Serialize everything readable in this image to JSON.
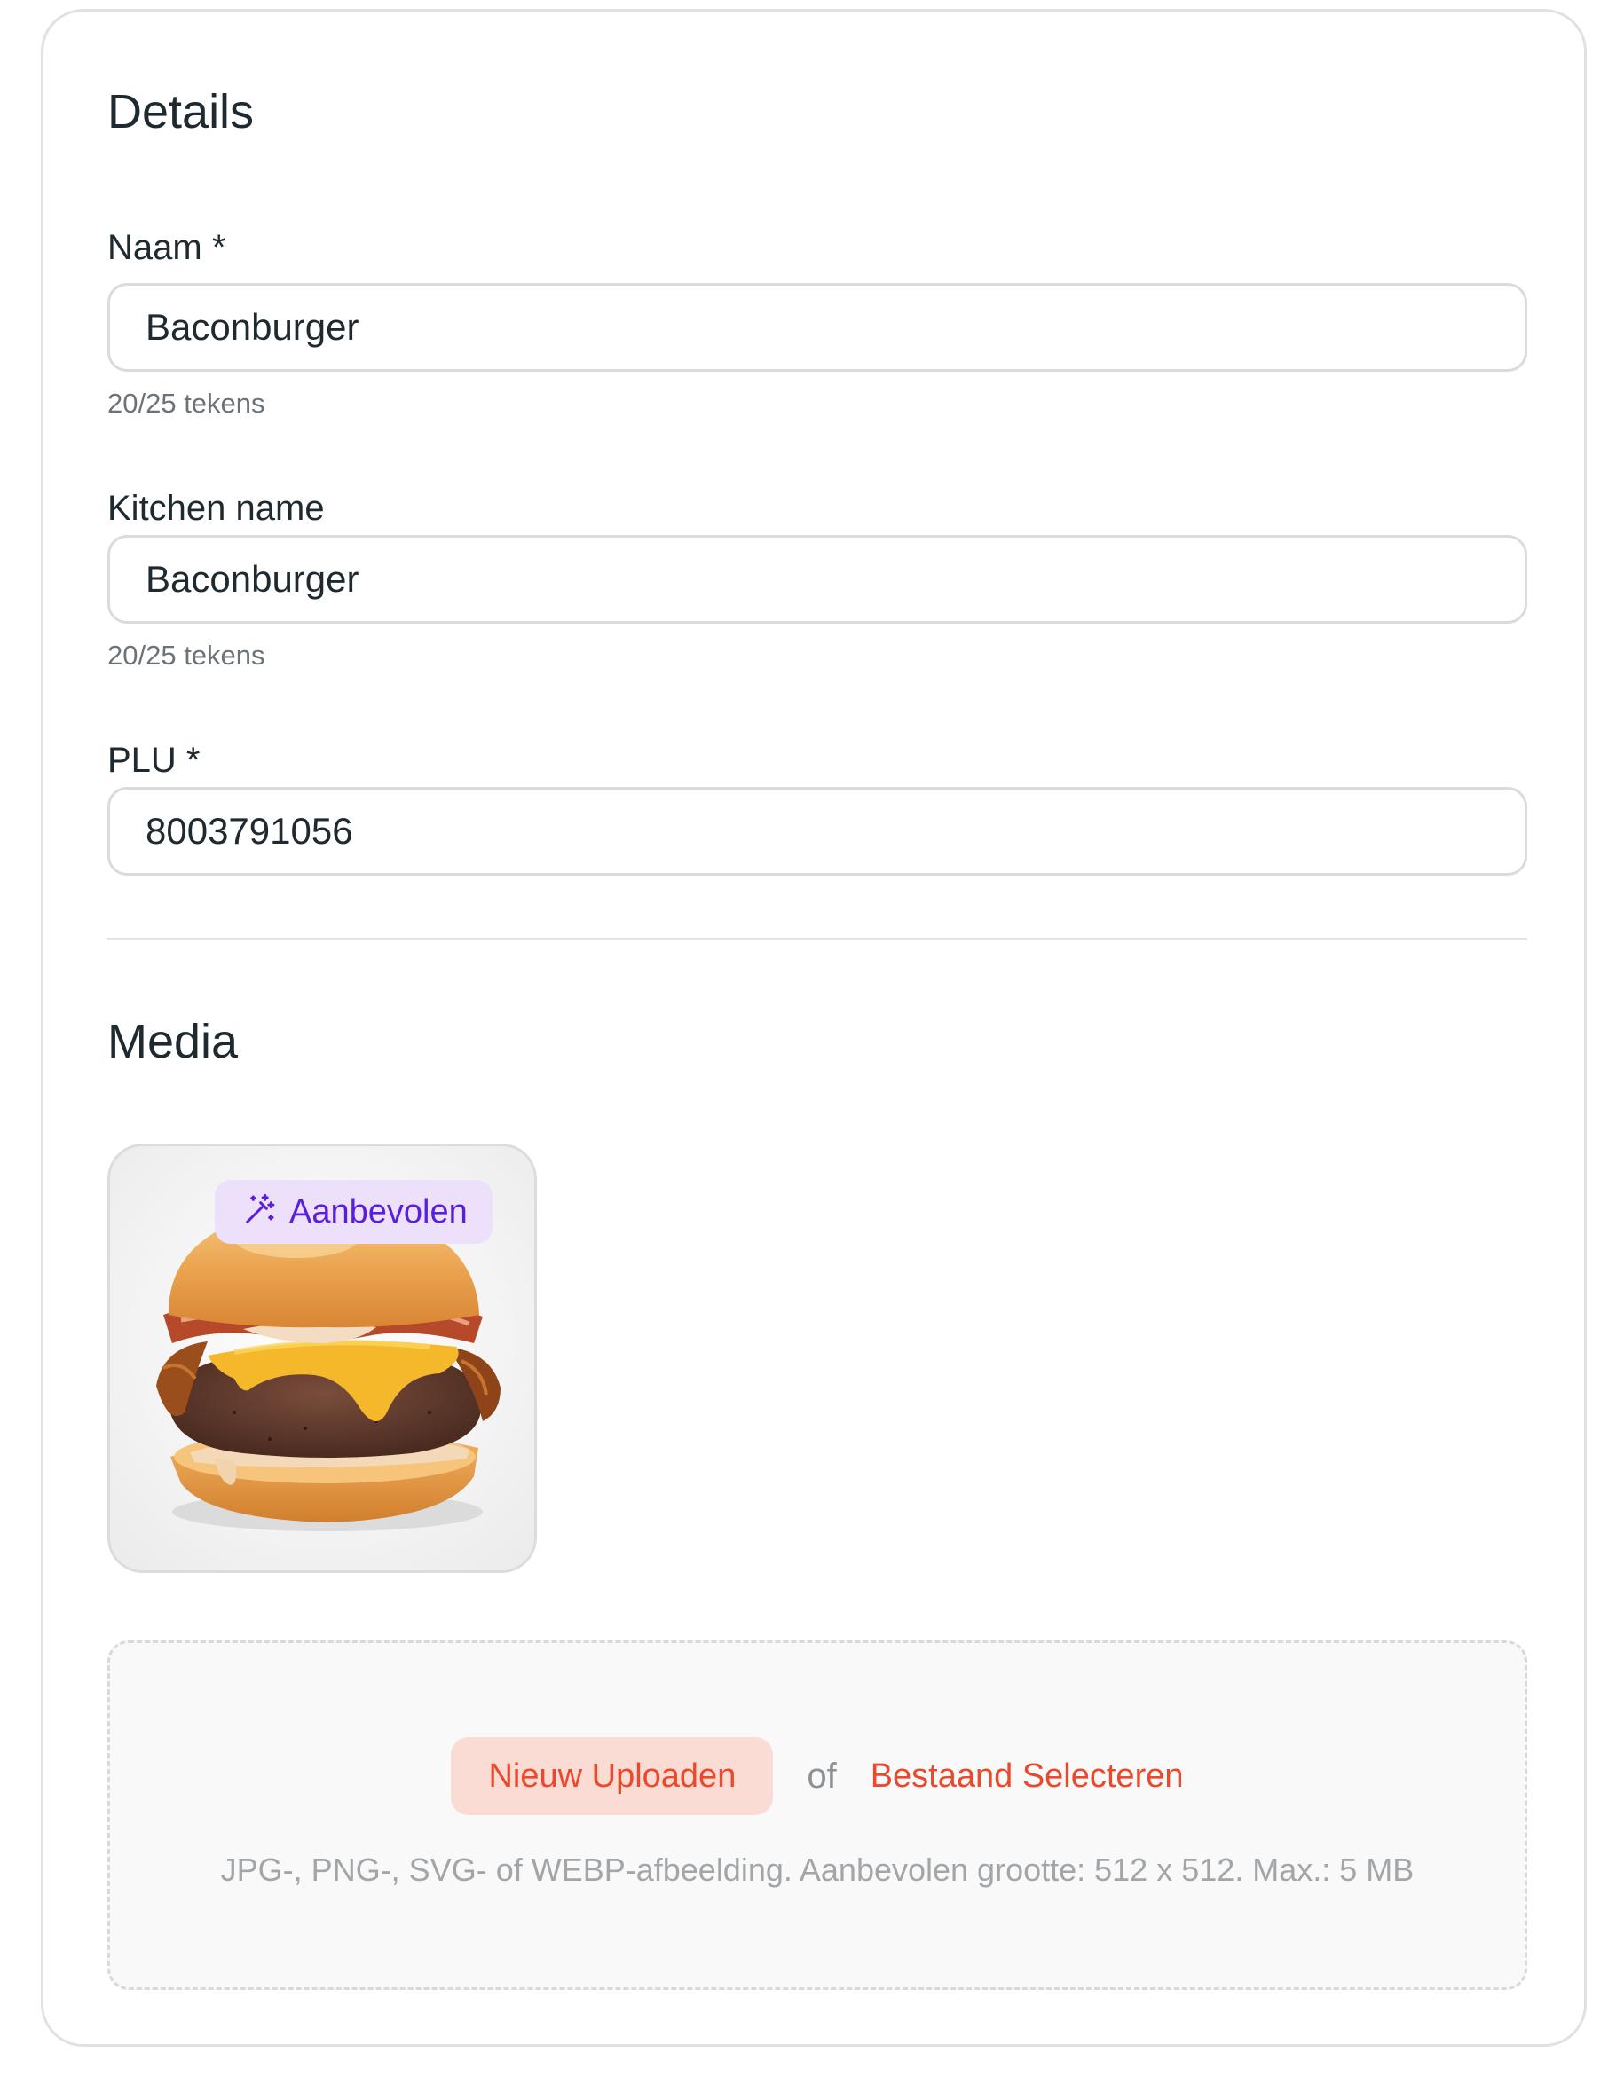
{
  "details": {
    "title": "Details",
    "name_field": {
      "label": "Naam *",
      "value": "Baconburger",
      "helper": "20/25 tekens"
    },
    "kitchen_name_field": {
      "label": "Kitchen name",
      "value": "Baconburger",
      "helper": "20/25 tekens"
    },
    "plu_field": {
      "label": "PLU *",
      "value": "8003791056"
    }
  },
  "media": {
    "title": "Media",
    "image": {
      "alt": "Baconburger",
      "badge_label": "Aanbevolen",
      "badge_icon": "magic-wand-icon"
    },
    "dropzone": {
      "upload_label": "Nieuw Uploaden",
      "or_label": "of",
      "select_label": "Bestaand Selecteren",
      "hint": "JPG-, PNG-, SVG- of WEBP-afbeelding. Aanbevolen grootte: 512 x 512. Max.: 5 MB"
    }
  },
  "colors": {
    "accent": "#ea4a2b",
    "accent_bg": "#fbdcd5",
    "badge_text": "#5a1fd6",
    "badge_bg": "#ece0fb",
    "text": "#1f2a30",
    "muted": "#6c7378"
  }
}
